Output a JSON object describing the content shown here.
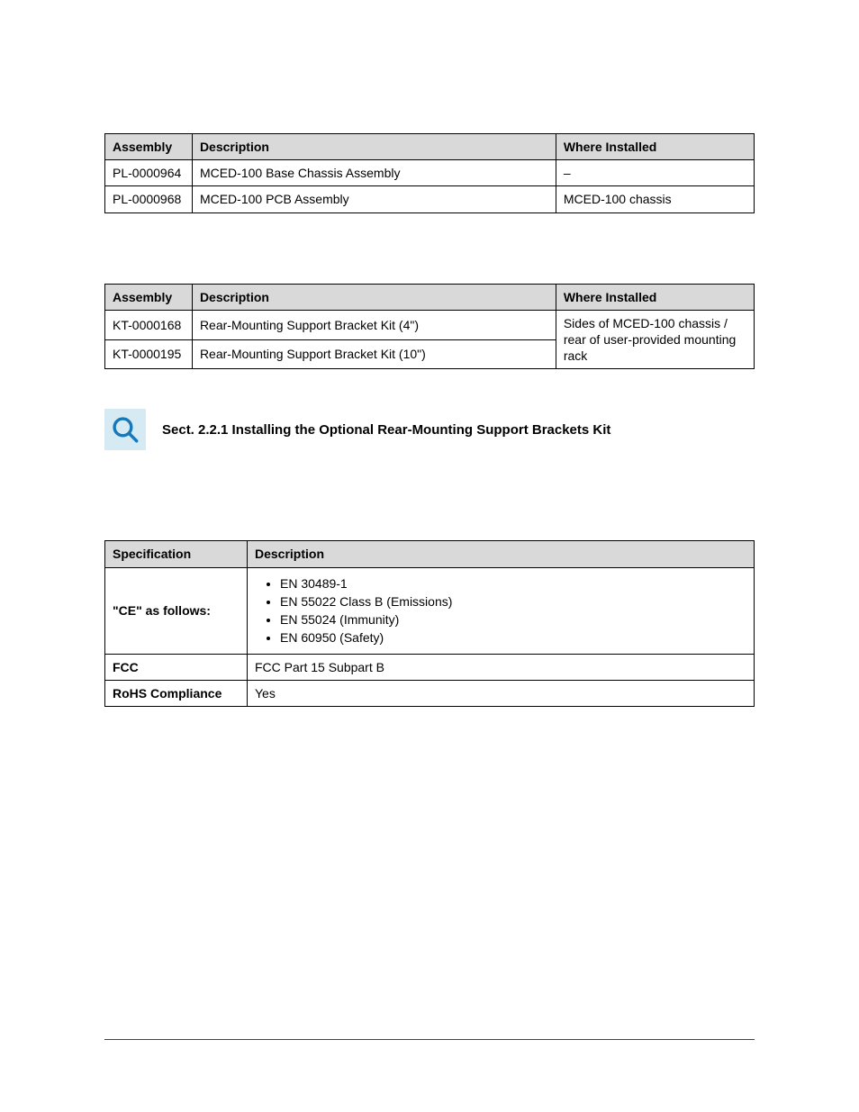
{
  "table1": {
    "headers": [
      "Assembly",
      "Description",
      "Where Installed"
    ],
    "rows": [
      {
        "assembly": "PL-0000964",
        "desc": "MCED-100 Base Chassis Assembly",
        "where": "–"
      },
      {
        "assembly": "PL-0000968",
        "desc": "MCED-100 PCB Assembly",
        "where": "MCED-100 chassis"
      }
    ]
  },
  "table2": {
    "headers": [
      "Assembly",
      "Description",
      "Where Installed"
    ],
    "rows": [
      {
        "assembly": "KT-0000168",
        "desc": "Rear-Mounting Support Bracket Kit (4\")"
      },
      {
        "assembly": "KT-0000195",
        "desc": "Rear-Mounting Support Bracket Kit (10\")"
      }
    ],
    "where_merged": "Sides of MCED-100 chassis / rear of user-provided mounting rack"
  },
  "section_ref": {
    "text": "Sect. 2.2.1 Installing the Optional Rear-Mounting Support Brackets Kit"
  },
  "table3": {
    "headers": [
      "Specification",
      "Description"
    ],
    "rows": [
      {
        "spec": "\"CE\" as follows:",
        "items": [
          "EN 30489-1",
          "EN 55022 Class B (Emissions)",
          "EN 55024 (Immunity)",
          "EN 60950 (Safety)"
        ]
      },
      {
        "spec": "FCC",
        "desc": "FCC Part 15 Subpart B"
      },
      {
        "spec": "RoHS Compliance",
        "desc": "Yes"
      }
    ]
  }
}
